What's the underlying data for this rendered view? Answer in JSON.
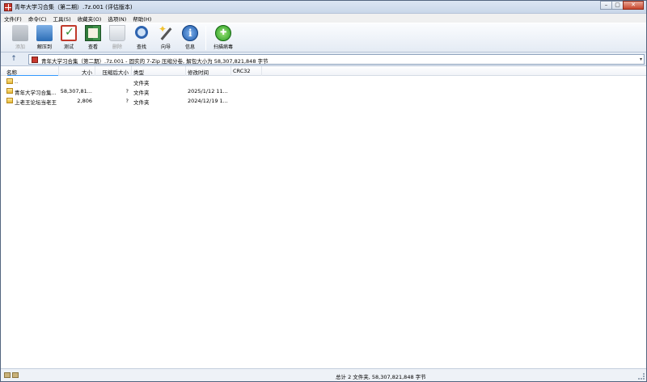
{
  "window": {
    "title": "青年大学习合集（第二期）.7z.001 (评估版本)",
    "controls": {
      "minimize": "–",
      "maximize": "▢",
      "close": "✕"
    }
  },
  "menu": [
    "文件(F)",
    "命令(C)",
    "工具(S)",
    "收藏夹(O)",
    "选项(N)",
    "帮助(H)"
  ],
  "toolbar": {
    "items": [
      {
        "label": "添加",
        "icon": "add-icon",
        "enabled": false
      },
      {
        "label": "解压到",
        "icon": "extract-icon",
        "enabled": true
      },
      {
        "label": "测试",
        "icon": "test-icon",
        "enabled": true
      },
      {
        "label": "查看",
        "icon": "view-icon",
        "enabled": true
      },
      {
        "label": "删除",
        "icon": "delete-icon",
        "enabled": false
      },
      {
        "label": "查找",
        "icon": "find-icon",
        "enabled": true
      },
      {
        "label": "向导",
        "icon": "wizard-icon",
        "enabled": true
      },
      {
        "label": "信息",
        "icon": "info-icon",
        "enabled": true
      },
      {
        "label": "扫描病毒",
        "icon": "scan-virus-icon",
        "enabled": true
      }
    ]
  },
  "addressbar": {
    "up_symbol": "↑",
    "path": "青年大学习合集（第二期）.7z.001 - 固实的 7-Zip 压缩分卷, 解包大小为 58,307,821,848 字节",
    "dropdown_symbol": "▾"
  },
  "columns": [
    "名称",
    "大小",
    "压缩后大小",
    "类型",
    "修改时间",
    "CRC32"
  ],
  "rows": [
    {
      "name": "..",
      "size": "",
      "packed": "",
      "type": "文件夹",
      "modified": "",
      "crc": ""
    },
    {
      "name": "青年大学习合集...",
      "size": "58,307,81...",
      "packed": "?",
      "type": "文件夹",
      "modified": "2025/1/12 11...",
      "crc": ""
    },
    {
      "name": "上老王论坛当老王",
      "size": "2,806",
      "packed": "?",
      "type": "文件夹",
      "modified": "2024/12/19 1...",
      "crc": ""
    }
  ],
  "status": {
    "text": "总计 2 文件夹, 58,307,821,848 字节"
  },
  "colors": {
    "accent": "#3399ff",
    "window_frame": "#53657f",
    "toolbar_bg": "#e4ebf4"
  }
}
